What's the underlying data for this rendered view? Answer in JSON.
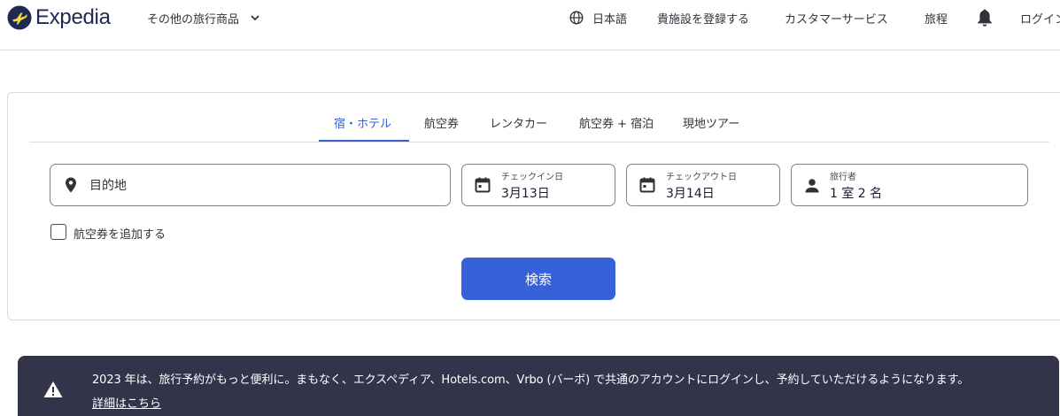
{
  "header": {
    "logo_text": "Expedia",
    "more_travel": "その他の旅行商品",
    "language": "日本語",
    "list_property": "貴施設を登録する",
    "support": "カスタマーサービス",
    "trips": "旅程",
    "login": "ログイン"
  },
  "tabs": [
    {
      "label": "宿・ホテル",
      "active": true
    },
    {
      "label": "航空券",
      "active": false
    },
    {
      "label": "レンタカー",
      "active": false
    },
    {
      "label": "航空券 + 宿泊",
      "active": false
    },
    {
      "label": "現地ツアー",
      "active": false
    }
  ],
  "search": {
    "destination_placeholder": "目的地",
    "checkin_label": "チェックイン日",
    "checkin_value": "3月13日",
    "checkout_label": "チェックアウト日",
    "checkout_value": "3月14日",
    "travelers_label": "旅行者",
    "travelers_value": "1 室 2 名",
    "add_flight_label": "航空券を追加する",
    "add_flight_checked": false,
    "search_button": "検索"
  },
  "banner": {
    "message": "2023 年は、旅行予約がもっと便利に。まもなく、エクスペディア、Hotels.com、Vrbo (バーボ) で共通のアカウントにログインし、予約していただけるようになります。",
    "link": "詳細はこちら"
  },
  "icons": {
    "logo": "expedia-plane-logo-icon",
    "globe": "globe-icon",
    "bell": "bell-icon",
    "location": "location-pin-icon",
    "calendar": "calendar-icon",
    "person": "person-icon",
    "warning": "warning-icon"
  },
  "colors": {
    "brand_navy": "#1e2a54",
    "logo_yellow": "#fddb32",
    "accent_blue": "#3661d8",
    "tab_active": "#3a5fcd",
    "banner_bg": "#33344a"
  }
}
